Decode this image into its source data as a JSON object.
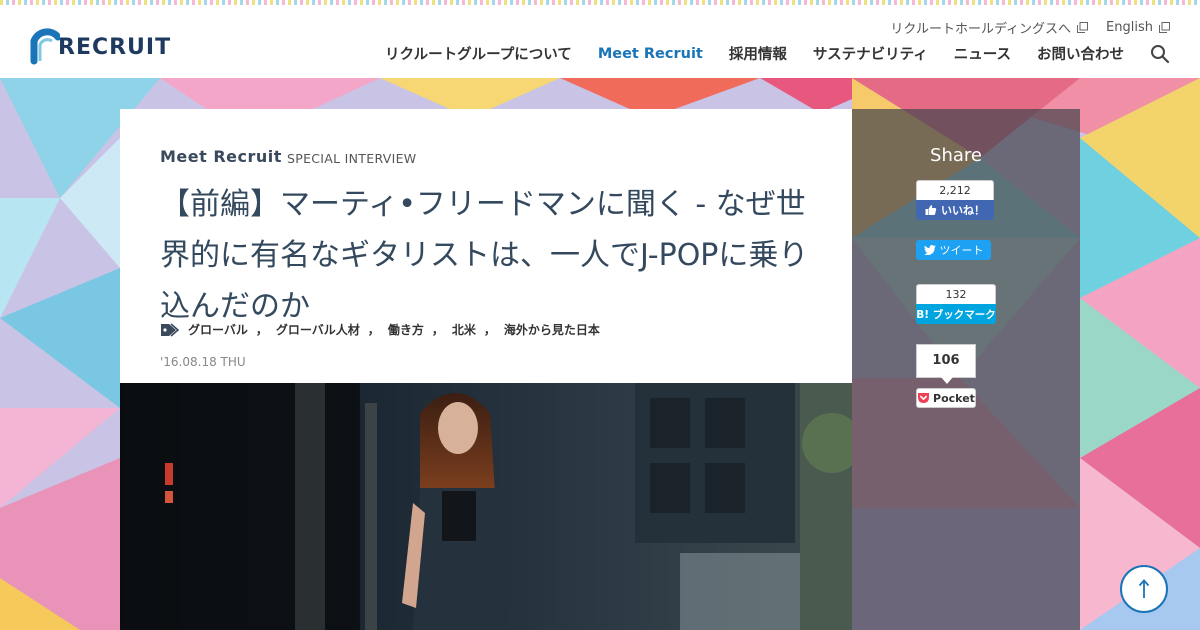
{
  "header": {
    "logo_text": "RECRUIT",
    "util_links": [
      {
        "label": "リクルートホールディングスへ",
        "icon": "external-link-icon"
      },
      {
        "label": "English",
        "icon": "external-link-icon"
      }
    ],
    "nav": [
      {
        "label": "リクルートグループについて"
      },
      {
        "label": "Meet Recruit",
        "active": true
      },
      {
        "label": "採用情報"
      },
      {
        "label": "サステナビリティ"
      },
      {
        "label": "ニュース"
      },
      {
        "label": "お問い合わせ"
      }
    ],
    "search_icon": "search-icon"
  },
  "article": {
    "category_brand": "Meet Recruit",
    "category_sub": "SPECIAL INTERVIEW",
    "title": "【前編】マーティ•フリードマンに聞く - なぜ世界的に有名なギタリストは、一人でJ-POPに乗り込んだのか",
    "tags": [
      "グローバル",
      "グローバル人材",
      "働き方",
      "北米",
      "海外から見た日本"
    ],
    "tag_separator": "，",
    "date": "'16.08.18 THU"
  },
  "share": {
    "title": "Share",
    "facebook": {
      "count": "2,212",
      "label": "いいね！"
    },
    "twitter": {
      "label": "ツイート"
    },
    "hatena": {
      "count": "132",
      "label": "B! ブックマーク"
    },
    "pocket": {
      "count": "106",
      "label": "Pocket"
    }
  },
  "colors": {
    "accent": "#1a74b8",
    "text": "#34495e",
    "facebook": "#4267b2",
    "twitter": "#1da1f2",
    "hatena": "#00a4de",
    "pocket": "#ef4056"
  }
}
